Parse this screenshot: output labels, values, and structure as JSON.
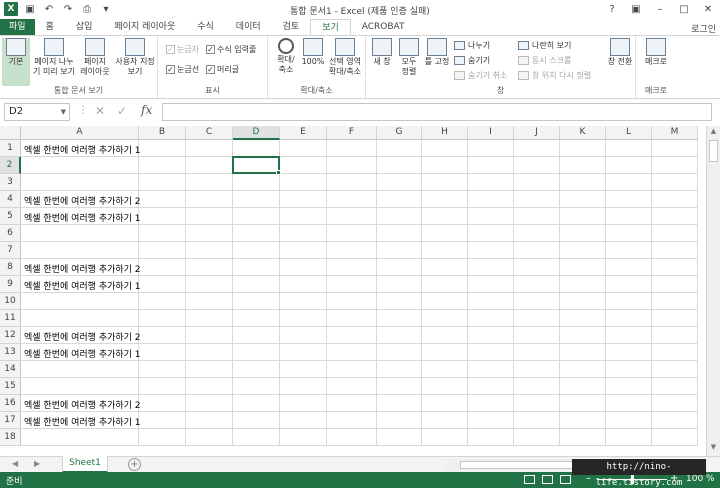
{
  "window": {
    "title": "통합 문서1 - Excel (제품 인증 실패)",
    "login": "로그인",
    "controls": {
      "help": "?",
      "restore_ribbon": "▣",
      "minimize": "–",
      "maximize": "□",
      "close": "✕"
    }
  },
  "quick_access": {
    "save_icon": "save-icon",
    "undo_icon": "undo-icon",
    "redo_icon": "redo-icon",
    "preview_icon": "print-preview-icon",
    "customize_icon": "customize-icon"
  },
  "tabs": [
    {
      "label": "파일",
      "kind": "file"
    },
    {
      "label": "홈"
    },
    {
      "label": "삽입"
    },
    {
      "label": "페이지 레이아웃"
    },
    {
      "label": "수식"
    },
    {
      "label": "데이터"
    },
    {
      "label": "검토"
    },
    {
      "label": "보기",
      "active": true
    },
    {
      "label": "ACROBAT"
    }
  ],
  "ribbon": {
    "workbook_views": {
      "label": "통합 문서 보기",
      "normal": "기본",
      "page_break": "페이지 나누\n기 미리 보기",
      "page_layout": "페이지\n레이아웃",
      "custom": "사용자 지정\n보기"
    },
    "show": {
      "label": "표시",
      "ruler": "눈금자",
      "formula_bar": "수식 입력줄",
      "gridlines": "눈금선",
      "headings": "머리글"
    },
    "zoom": {
      "label": "확대/축소",
      "zoom": "확대/\n축소",
      "zoom100": "100%",
      "zoom_selection": "선택 영역\n확대/축소"
    },
    "window": {
      "label": "창",
      "new_window": "새 창",
      "arrange_all": "모두\n정렬",
      "freeze": "틀 고정",
      "split": "나누기",
      "hide": "숨기기",
      "unhide": "숨기기 취소",
      "side_by_side": "나란히 보기",
      "sync_scroll": "동시 스크롤",
      "reset_position": "창 위치 다시 정렬",
      "switch_windows": "창 전환"
    },
    "macros": {
      "label": "매크로",
      "macros": "매크로"
    }
  },
  "formula_bar": {
    "name_box": "D2",
    "cancel": "✕",
    "enter": "✓",
    "fx": "fx",
    "content": ""
  },
  "columns": [
    "A",
    "B",
    "C",
    "D",
    "E",
    "F",
    "G",
    "H",
    "I",
    "J",
    "K",
    "L",
    "M"
  ],
  "selected_column": "D",
  "selected_row": "2",
  "rows": [
    {
      "n": "1",
      "a": "엑셀 한번에 여러행 추가하기 1"
    },
    {
      "n": "2",
      "a": ""
    },
    {
      "n": "3",
      "a": ""
    },
    {
      "n": "4",
      "a": "엑셀 한번에 여러행 추가하기 2"
    },
    {
      "n": "5",
      "a": "엑셀 한번에 여러행 추가하기 1"
    },
    {
      "n": "6",
      "a": ""
    },
    {
      "n": "7",
      "a": ""
    },
    {
      "n": "8",
      "a": "엑셀 한번에 여러행 추가하기 2"
    },
    {
      "n": "9",
      "a": "엑셀 한번에 여러행 추가하기 1"
    },
    {
      "n": "10",
      "a": ""
    },
    {
      "n": "11",
      "a": ""
    },
    {
      "n": "12",
      "a": "엑셀 한번에 여러행 추가하기 2"
    },
    {
      "n": "13",
      "a": "엑셀 한번에 여러행 추가하기 1"
    },
    {
      "n": "14",
      "a": ""
    },
    {
      "n": "15",
      "a": ""
    },
    {
      "n": "16",
      "a": "엑셀 한번에 여러행 추가하기 2"
    },
    {
      "n": "17",
      "a": "엑셀 한번에 여러행 추가하기 1"
    },
    {
      "n": "18",
      "a": ""
    }
  ],
  "sheets": {
    "active": "Sheet1",
    "add_label": "+"
  },
  "status": {
    "ready": "준비",
    "zoom": "100 %",
    "zoom_minus": "–",
    "zoom_plus": "+"
  },
  "watermark": "http://nino-life.tistory.com",
  "colors": {
    "accent": "#217346",
    "gridline": "#d9d9d9",
    "header_bg": "#f3f3f3"
  }
}
